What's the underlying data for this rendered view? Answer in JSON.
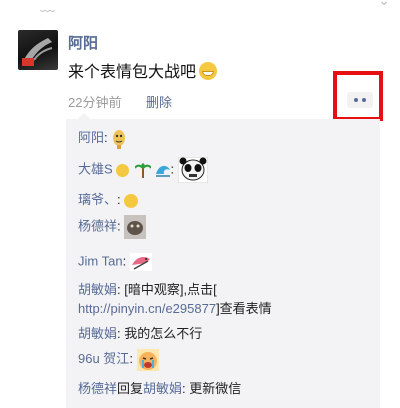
{
  "post": {
    "author": "阿阳",
    "text": "来个表情包大战吧",
    "time": "22分钟前",
    "delete_label": "删除"
  },
  "comments": [
    {
      "name": "阿阳",
      "suffix": ":"
    },
    {
      "name": "大雄S",
      "suffix": ":"
    },
    {
      "name": "璃爷、",
      "suffix": ":"
    },
    {
      "name": "杨德祥",
      "suffix": ":"
    },
    {
      "name": "Jim Tan",
      "suffix": ":"
    },
    {
      "name": "胡敏娟",
      "text1": ": [暗中观察],点击[",
      "link": "http://pinyin.cn/e295877",
      "text2": "]查看表情"
    },
    {
      "name": "胡敏娟",
      "text": ": 我的怎么不行"
    },
    {
      "name": "96u 贺江",
      "suffix": ":"
    },
    {
      "name": "杨德祥",
      "reply_word": "回复",
      "reply_to": "胡敏娟",
      "text": ": 更新微信"
    }
  ],
  "colors": {
    "link": "#576b95",
    "highlight_box": "#e60f12",
    "comment_bg": "#f3f3f5"
  },
  "icons": [
    "avatar",
    "flag-icon",
    "grin-emoji-icon",
    "more-options-icon",
    "smile-emoji-icon",
    "palm-tree-icon",
    "wave-icon",
    "panda-sticker",
    "cat-photo-sticker",
    "bird-sticker",
    "crying-sticker",
    "cookie-sticker"
  ]
}
